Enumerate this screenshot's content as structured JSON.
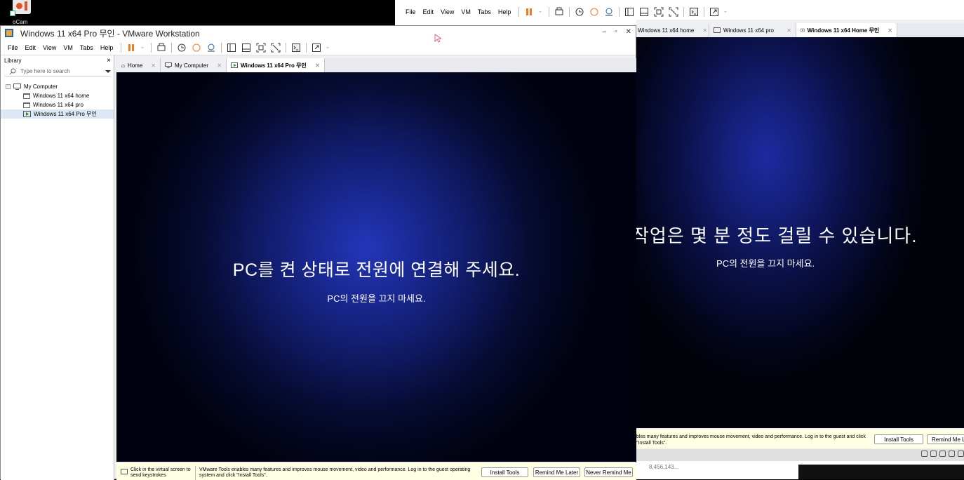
{
  "desktop": {
    "ocam_label": "oCam"
  },
  "back_window": {
    "menu": [
      "File",
      "Edit",
      "View",
      "VM",
      "Tabs",
      "Help"
    ],
    "tabs": [
      {
        "label": "Windows 11 x64 home",
        "active": false
      },
      {
        "label": "Windows 11 x64 pro",
        "active": false
      },
      {
        "label": "Windows 11 x64 Home 무인",
        "active": true
      }
    ],
    "vm_screen": {
      "heading": "작업은 몇 분 정도 걸릴 수 있습니다.",
      "subtext": "PC의 전원을 끄지 마세요."
    },
    "notification": {
      "text": "bles many features and improves mouse movement, video and performance. Log in to the guest and click \"Install Tools\".",
      "install_button": "Install Tools",
      "remind_button": "Remind Me Lat"
    },
    "lower_text": "8,456,143..."
  },
  "front_window": {
    "title": "Windows 11 x64 Pro 무인 - VMware Workstation",
    "menu": [
      "File",
      "Edit",
      "View",
      "VM",
      "Tabs",
      "Help"
    ],
    "library": {
      "header": "Library",
      "close": "×",
      "search_placeholder": "Type here to search",
      "tree": {
        "root": "My Computer",
        "items": [
          {
            "label": "Windows 11 x64 home",
            "selected": false
          },
          {
            "label": "Windows 11 x64 pro",
            "selected": false
          },
          {
            "label": "Windows 11 x64 Pro 무인",
            "selected": true
          }
        ]
      }
    },
    "tabs": [
      {
        "label": "Home",
        "active": false
      },
      {
        "label": "My Computer",
        "active": false
      },
      {
        "label": "Windows 11 x64 Pro 무인",
        "active": true
      }
    ],
    "vm_screen": {
      "heading": "PC를 켠 상태로 전원에 연결해 주세요.",
      "subtext": "PC의 전원을 끄지 마세요."
    },
    "notification": {
      "hint": "Click in the virtual screen to send keystrokes",
      "text": "VMware Tools enables many features and improves mouse movement, video and performance. Log in to the guest operating system and click \"Install Tools\".",
      "install_button": "Install Tools",
      "remind_button": "Remind Me Later",
      "never_button": "Never Remind Me"
    }
  },
  "colors": {
    "pause_orange": "#f07c1c",
    "vm_blue": "#1d2aa0",
    "notify_yellow": "#ffffe4"
  }
}
